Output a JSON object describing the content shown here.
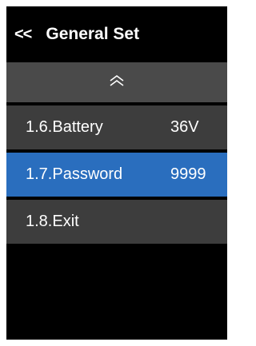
{
  "header": {
    "back_label": "<<",
    "title": "General Set"
  },
  "scroll_up": {
    "icon": "double-chevron-up-icon"
  },
  "menu": {
    "items": [
      {
        "label": "1.6.Battery",
        "value": "36V",
        "selected": false
      },
      {
        "label": "1.7.Password",
        "value": "9999",
        "selected": true
      },
      {
        "label": "1.8.Exit",
        "value": "",
        "selected": false
      }
    ]
  },
  "colors": {
    "background": "#000000",
    "item": "#3d3d3d",
    "scroll_bar": "#4a4a4a",
    "selected": "#2a6ebe",
    "text": "#ffffff"
  }
}
